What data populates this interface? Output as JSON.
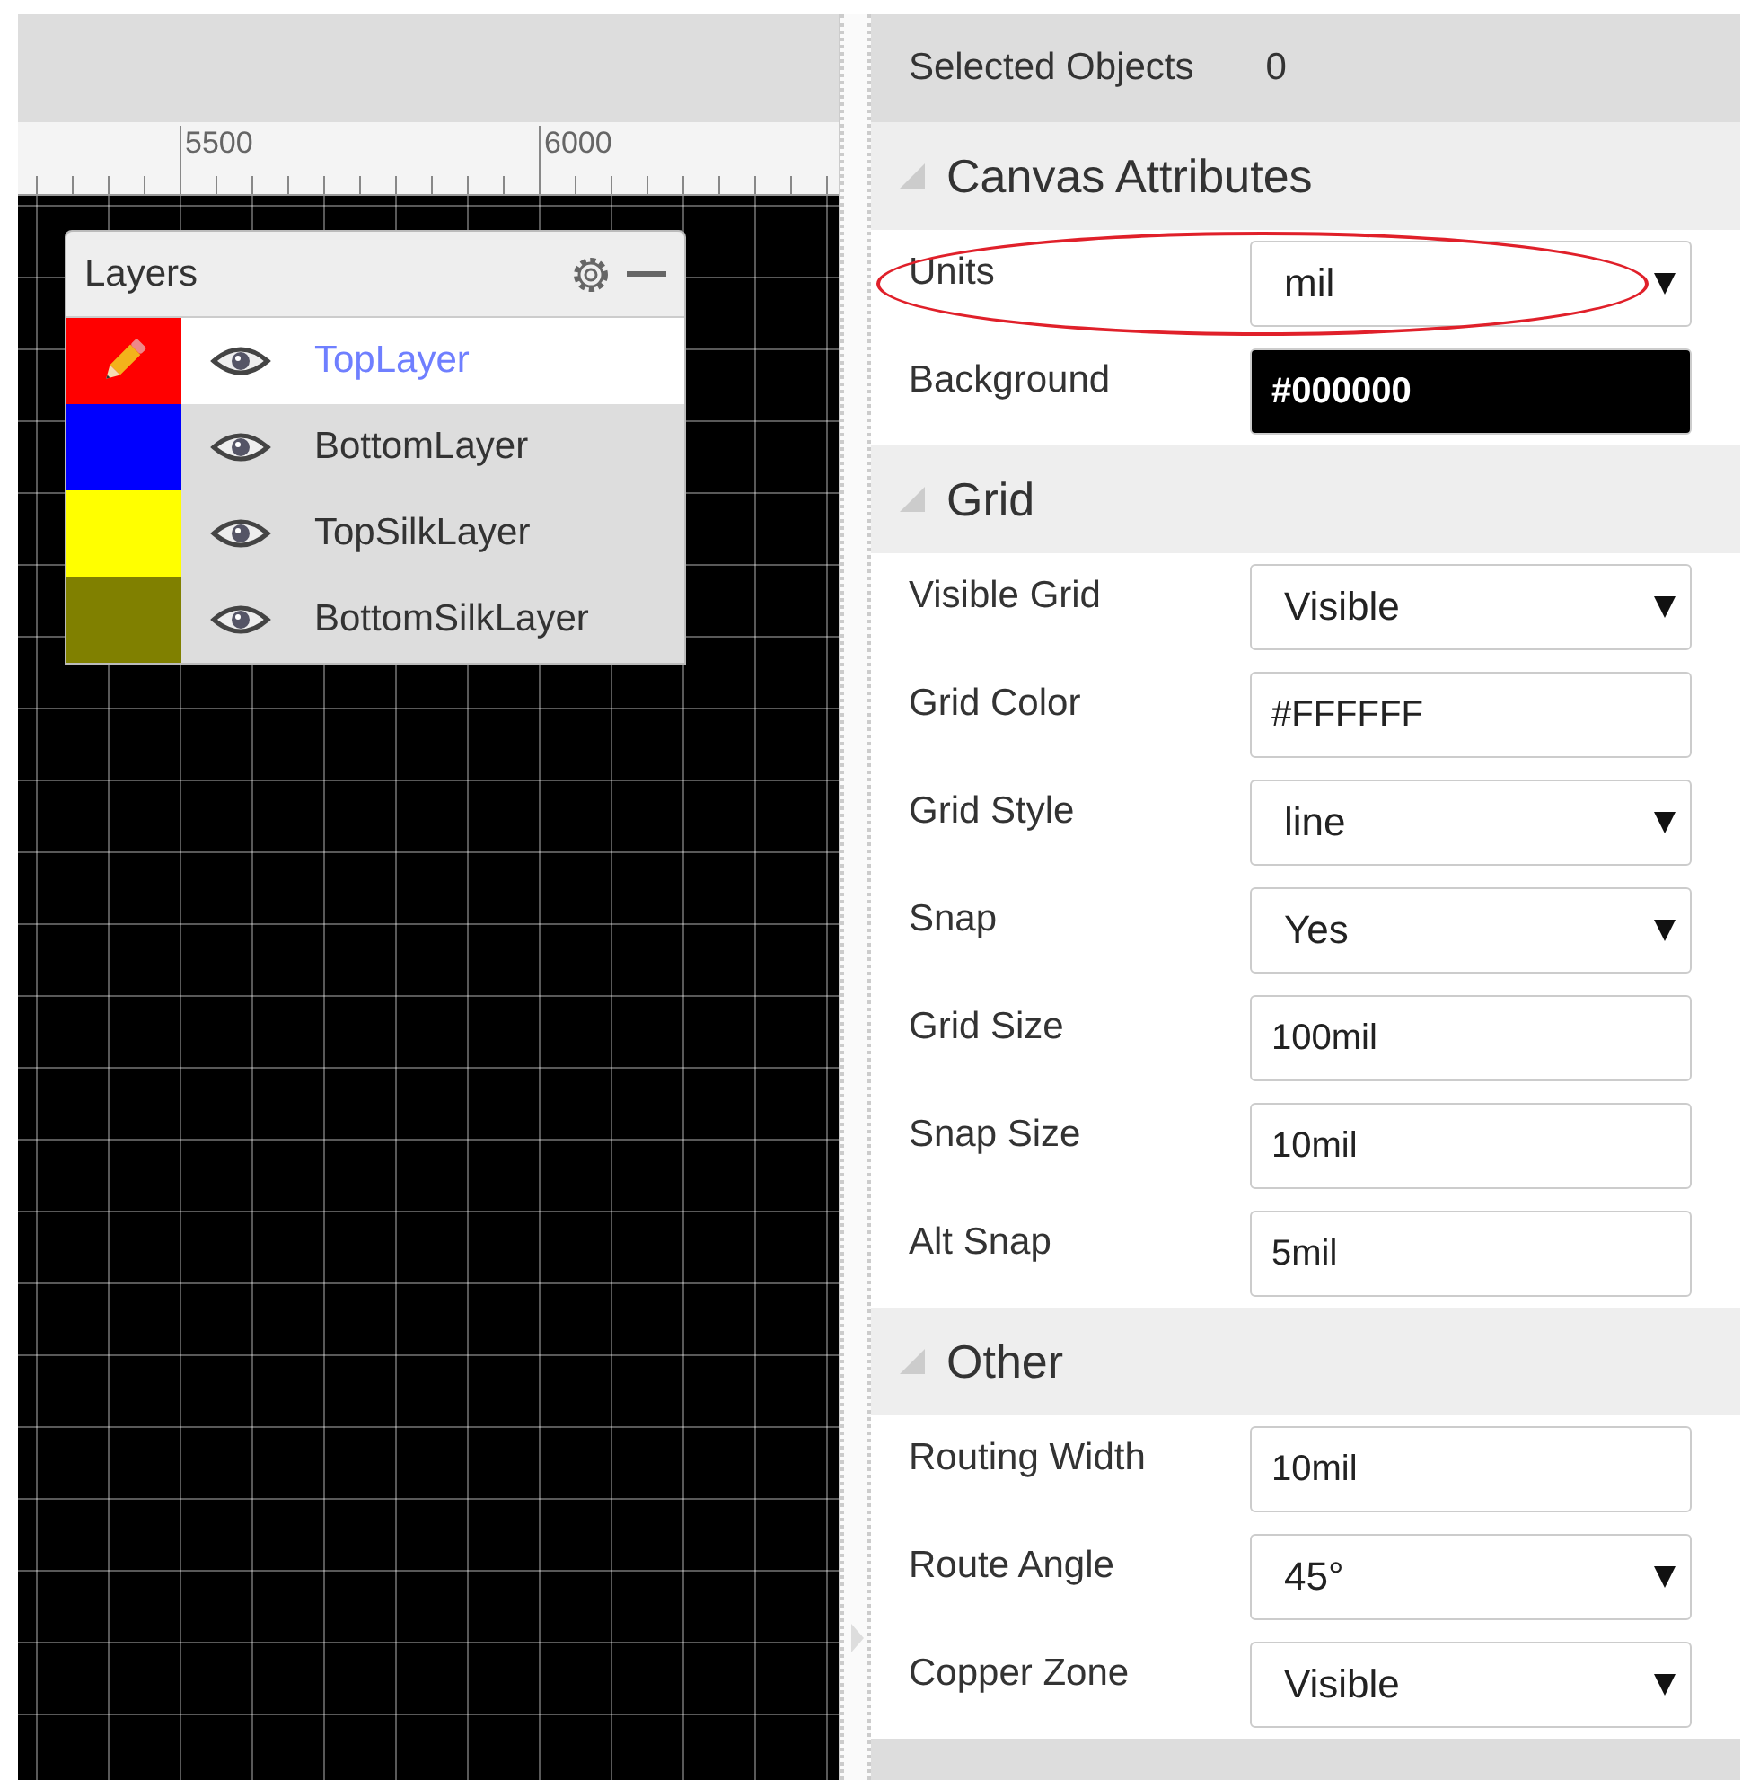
{
  "ruler": {
    "labels": [
      "5500",
      "6000"
    ]
  },
  "layers": {
    "title": "Layers",
    "items": [
      {
        "name": "TopLayer",
        "color": "#ff0000",
        "selected": true,
        "visible": true
      },
      {
        "name": "BottomLayer",
        "color": "#0000ff",
        "selected": false,
        "visible": true
      },
      {
        "name": "TopSilkLayer",
        "color": "#ffff00",
        "selected": false,
        "visible": true
      },
      {
        "name": "BottomSilkLayer",
        "color": "#808000",
        "selected": false,
        "visible": true
      }
    ]
  },
  "properties": {
    "selected_objects": {
      "label": "Selected Objects",
      "value": "0"
    },
    "sections": [
      {
        "title": "Canvas Attributes",
        "rows": [
          {
            "label": "Units",
            "kind": "select",
            "value": "mil",
            "highlighted": true
          },
          {
            "label": "Background",
            "kind": "color",
            "value": "#000000",
            "highlighted": false
          }
        ]
      },
      {
        "title": "Grid",
        "rows": [
          {
            "label": "Visible Grid",
            "kind": "select",
            "value": "Visible",
            "highlighted": false
          },
          {
            "label": "Grid Color",
            "kind": "text",
            "value": "#FFFFFF",
            "highlighted": false
          },
          {
            "label": "Grid Style",
            "kind": "select",
            "value": "line",
            "highlighted": false
          },
          {
            "label": "Snap",
            "kind": "select",
            "value": "Yes",
            "highlighted": false
          },
          {
            "label": "Grid Size",
            "kind": "text",
            "value": "100mil",
            "highlighted": false
          },
          {
            "label": "Snap Size",
            "kind": "text",
            "value": "10mil",
            "highlighted": false
          },
          {
            "label": "Alt Snap",
            "kind": "text",
            "value": "5mil",
            "highlighted": false
          }
        ]
      },
      {
        "title": "Other",
        "rows": [
          {
            "label": "Routing Width",
            "kind": "text",
            "value": "10mil",
            "highlighted": false
          },
          {
            "label": "Route Angle",
            "kind": "select",
            "value": "45°",
            "highlighted": false
          },
          {
            "label": "Copper Zone",
            "kind": "select",
            "value": "Visible",
            "highlighted": false
          }
        ]
      }
    ]
  }
}
